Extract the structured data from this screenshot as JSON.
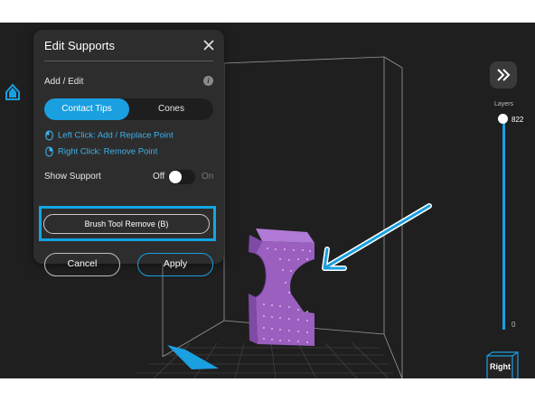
{
  "panel": {
    "title": "Edit Supports",
    "section_label": "Add / Edit",
    "tabs": [
      {
        "label": "Contact Tips",
        "active": true
      },
      {
        "label": "Cones",
        "active": false
      }
    ],
    "hints": [
      {
        "text": "Left Click: Add / Replace Point",
        "icon": "mouse-left-icon"
      },
      {
        "text": "Right Click: Remove Point",
        "icon": "mouse-right-icon"
      }
    ],
    "show_support": {
      "label": "Show Support",
      "off_label": "Off",
      "on_label": "On",
      "state": "off"
    },
    "brush_button": "Brush Tool Remove (B)",
    "cancel_label": "Cancel",
    "apply_label": "Apply"
  },
  "layers": {
    "label": "Layers",
    "max": "822",
    "min": "0",
    "value_fraction": 1.0
  },
  "view_cube": {
    "label": "Right"
  },
  "colors": {
    "accent": "#1a9fe0",
    "highlight": "#10a6e4",
    "model": "#9b5fc0",
    "panel_bg": "#2d2d2d",
    "viewport_bg": "#1f1f1f"
  }
}
